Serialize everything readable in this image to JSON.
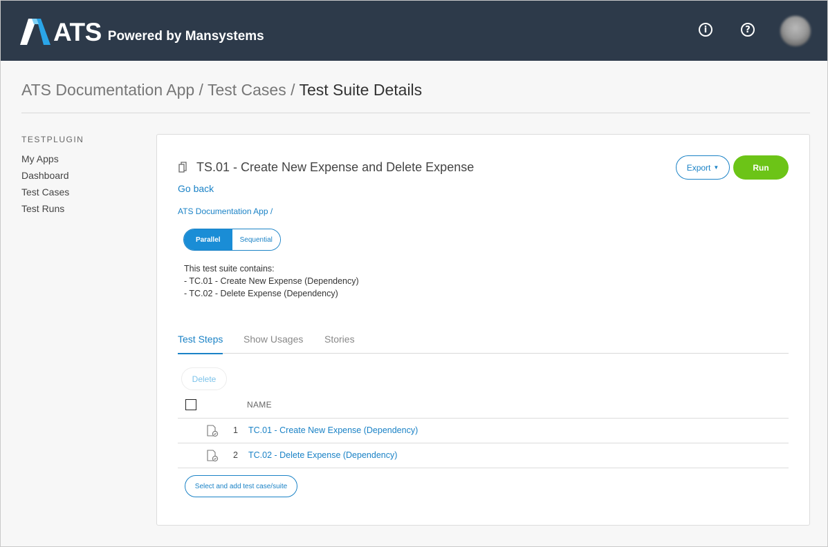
{
  "header": {
    "brand": "ATS",
    "tagline": "Powered by Mansystems",
    "info_icon": "info-icon",
    "help_icon": "help-icon"
  },
  "breadcrumb": {
    "part1": "ATS Documentation App",
    "sep1": " / ",
    "part2": "Test Cases",
    "sep2": " / ",
    "current": "Test Suite Details"
  },
  "sidebar": {
    "heading": "TESTPLUGIN",
    "items": [
      {
        "label": "My Apps"
      },
      {
        "label": "Dashboard"
      },
      {
        "label": "Test Cases"
      },
      {
        "label": "Test Runs"
      }
    ]
  },
  "suite": {
    "title": "TS.01 - Create New Expense and Delete Expense",
    "go_back": "Go back",
    "app_link": "ATS Documentation App",
    "app_sep": "/",
    "export_label": "Export",
    "run_label": "Run",
    "mode": {
      "parallel": "Parallel",
      "sequential": "Sequential",
      "selected": "Parallel"
    },
    "description": [
      "This test suite contains:",
      "- TC.01 - Create New Expense (Dependency)",
      "- TC.02 - Delete Expense (Dependency)"
    ]
  },
  "tabs": [
    {
      "label": "Test Steps",
      "active": true
    },
    {
      "label": "Show Usages",
      "active": false
    },
    {
      "label": "Stories",
      "active": false
    }
  ],
  "steps": {
    "delete_label": "Delete",
    "column_name": "NAME",
    "rows": [
      {
        "num": "1",
        "name": "TC.01 - Create New Expense (Dependency)"
      },
      {
        "num": "2",
        "name": "TC.02 - Delete Expense (Dependency)"
      }
    ],
    "add_label": "Select and add test case/suite"
  },
  "colors": {
    "header_bg": "#2d3a4a",
    "accent": "#1a82c6",
    "run_green": "#6cc417",
    "logo_blue": "#2aa5e8"
  }
}
